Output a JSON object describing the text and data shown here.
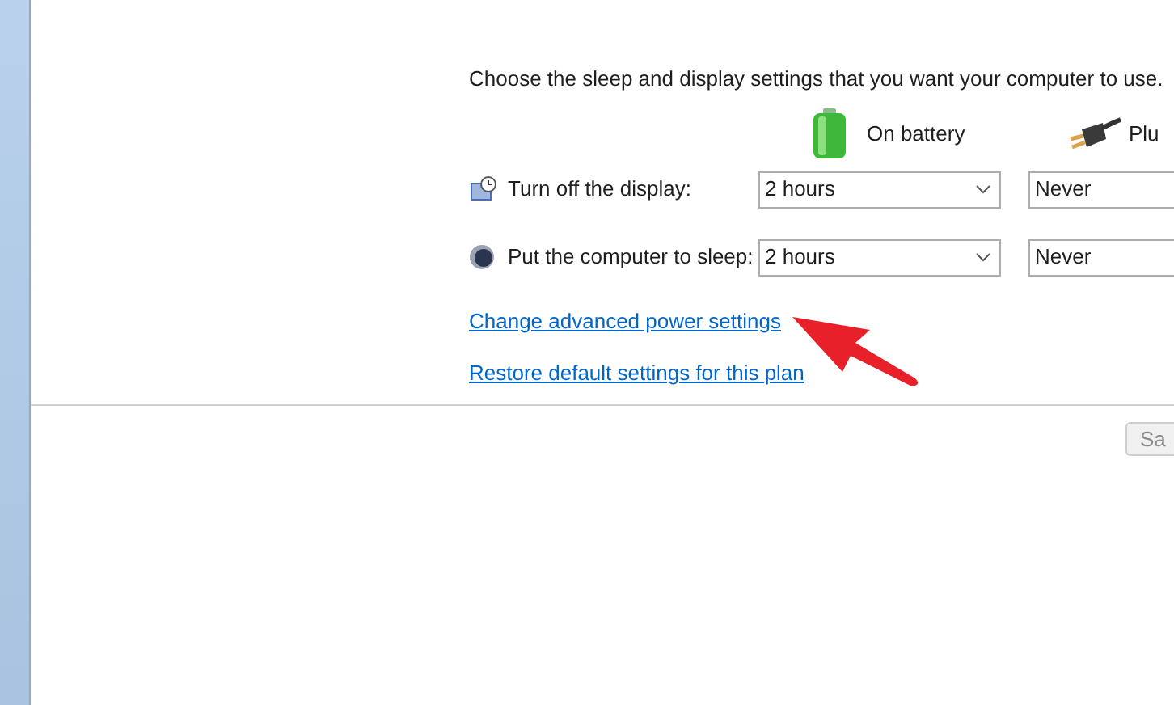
{
  "intro": "Choose the sleep and display settings that you want your computer to use.",
  "columns": [
    {
      "label": "On battery",
      "kind": "battery"
    },
    {
      "label": "Plu",
      "kind": "plug"
    }
  ],
  "settings": [
    {
      "label": "Turn off the display:",
      "kind": "display",
      "values": [
        "2 hours",
        "Never"
      ]
    },
    {
      "label": "Put the computer to sleep:",
      "kind": "sleep",
      "values": [
        "2 hours",
        "Never"
      ]
    }
  ],
  "links": [
    "Change advanced power settings",
    "Restore default settings for this plan"
  ],
  "button": "Sa"
}
